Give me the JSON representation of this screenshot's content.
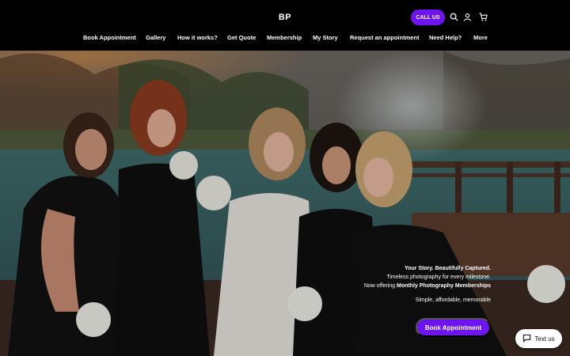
{
  "header": {
    "logo": "BP",
    "call_label": "CALL US",
    "icons": [
      "search-icon",
      "user-icon",
      "cart-icon"
    ]
  },
  "nav": {
    "items": [
      {
        "label": "Book Appointment"
      },
      {
        "label": "Gallery"
      },
      {
        "label": "How it works?"
      },
      {
        "label": "Get Quote"
      },
      {
        "label": "Membership"
      },
      {
        "label": "My Story"
      },
      {
        "label": "Request an appointment"
      },
      {
        "label": "Need Help?"
      },
      {
        "label": "More"
      }
    ]
  },
  "hero": {
    "headline": "Your Story. Beautifully Captured.",
    "line2": "Timeless photography for every milestone.",
    "line3_prefix": "Now offering ",
    "line3_bold": "Monthly Photography Memberships",
    "sub": "Simple, affordable, memorable",
    "cta_label": "Book Appointment"
  },
  "chat": {
    "label": "Text us",
    "icon": "chat-icon"
  },
  "colors": {
    "accent": "#6d14f0",
    "header_bg": "#000000"
  }
}
